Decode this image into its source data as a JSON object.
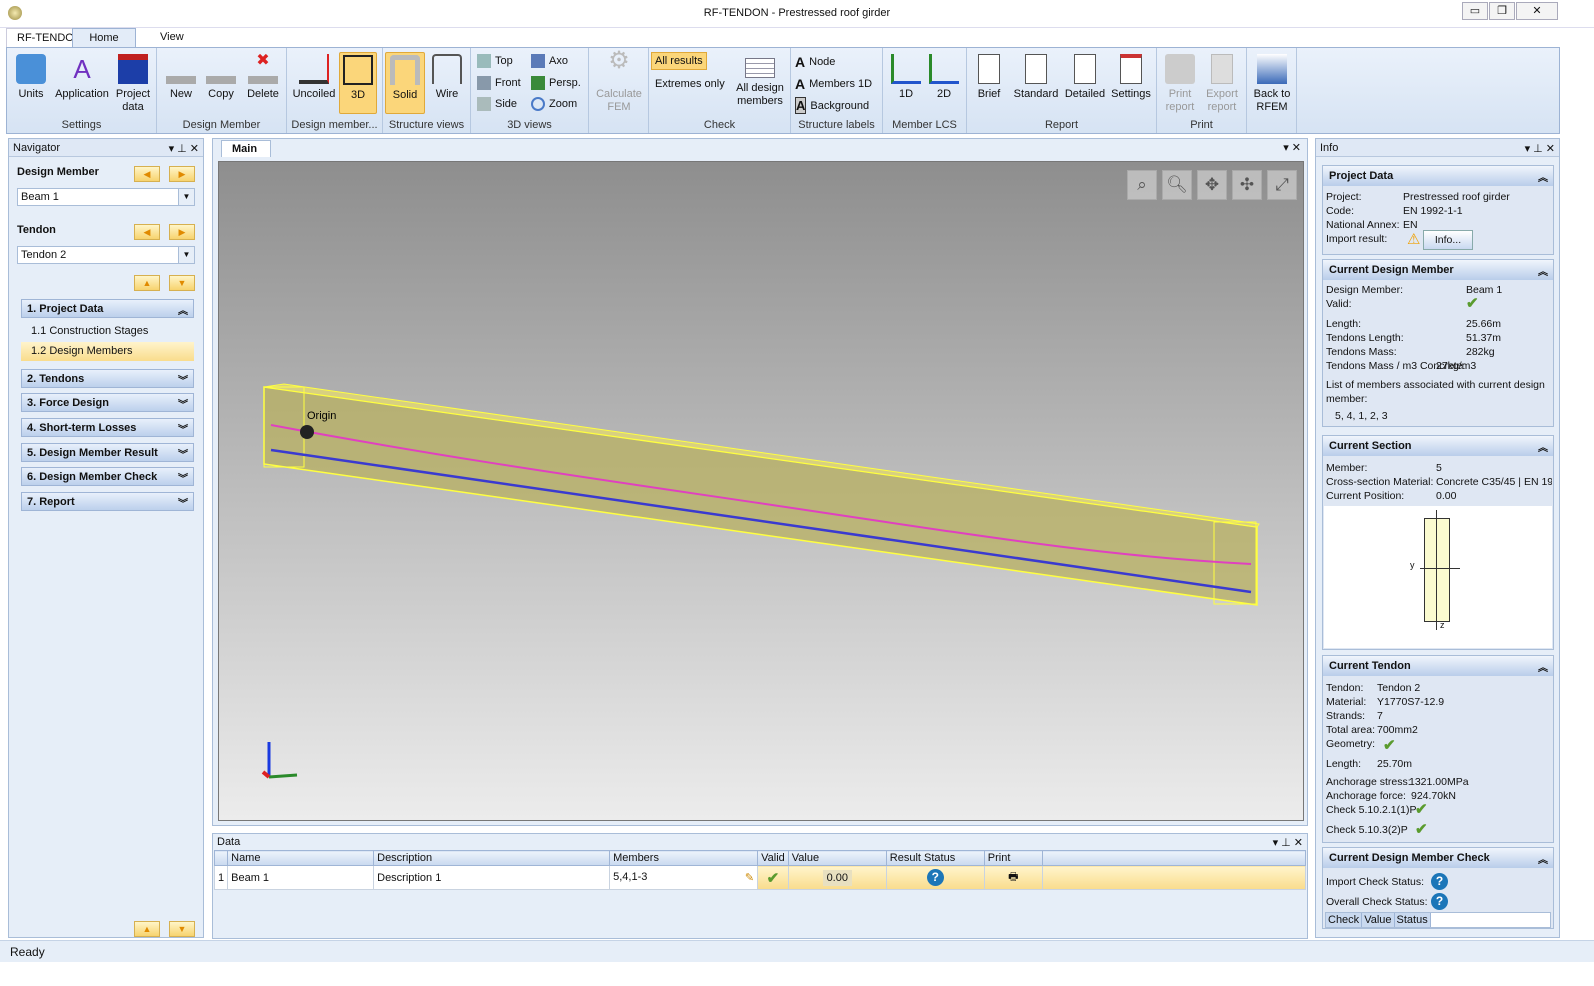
{
  "window": {
    "title": "RF-TENDON - Prestressed roof girder",
    "minimize": "▭",
    "restore": "❐",
    "close": "✕"
  },
  "tabs": [
    "RF-TENDON",
    "Home",
    "View"
  ],
  "ribbon": {
    "groups": [
      "Settings",
      "Design Member",
      "Design member...",
      "Structure views",
      "3D views",
      "",
      "Check",
      "Structure labels",
      "Member LCS",
      "Report",
      "Print",
      ""
    ],
    "settings": [
      "Units",
      "Application",
      "Project data"
    ],
    "design_member": [
      "New",
      "Copy",
      "Delete"
    ],
    "design_member2": [
      "Uncoiled",
      "3D"
    ],
    "structure_views": [
      "Solid",
      "Wire"
    ],
    "views3d": [
      "Top",
      "Front",
      "Side",
      "Axo",
      "Persp.",
      "Zoom"
    ],
    "calculate": "Calculate FEM",
    "check": [
      "All results",
      "Extremes only",
      "All design members"
    ],
    "labels": [
      "Node",
      "Members 1D",
      "Background"
    ],
    "lcs": [
      "1D",
      "2D"
    ],
    "report": [
      "Brief",
      "Standard",
      "Detailed",
      "Settings"
    ],
    "print": [
      "Print report",
      "Export report"
    ],
    "back": "Back to RFEM"
  },
  "navigator": {
    "title": "Navigator",
    "design_member_label": "Design Member",
    "design_member_value": "Beam 1",
    "tendon_label": "Tendon",
    "tendon_value": "Tendon 2",
    "sections": [
      {
        "label": "1. Project Data",
        "expanded": true,
        "items": [
          "1.1 Construction Stages",
          "1.2 Design Members"
        ],
        "selected": "1.2 Design Members"
      },
      {
        "label": "2. Tendons"
      },
      {
        "label": "3. Force Design"
      },
      {
        "label": "4. Short-term Losses"
      },
      {
        "label": "5. Design Member Result"
      },
      {
        "label": "6. Design Member Check"
      },
      {
        "label": "7. Report"
      }
    ]
  },
  "main": {
    "tab": "Main",
    "origin_label": "Origin",
    "colors": {
      "tendon_top": "#e040c0",
      "tendon_bottom": "#3a3ad0",
      "beam": "#c8c060"
    }
  },
  "data_panel": {
    "title": "Data",
    "columns": [
      "Name",
      "Description",
      "Members",
      "Valid",
      "Value",
      "Result Status",
      "Print"
    ],
    "rows": [
      {
        "index": "1",
        "name": "Beam 1",
        "description": "Description 1",
        "members": "5,4,1-3",
        "valid": "✔",
        "value": "0.00",
        "result_status": "?",
        "print": "🖶"
      }
    ]
  },
  "info": {
    "title": "Info",
    "project_data": {
      "title": "Project Data",
      "rows": [
        [
          "Project:",
          "Prestressed roof girder"
        ],
        [
          "Code:",
          "EN 1992-1-1"
        ],
        [
          "National Annex:",
          "EN"
        ],
        [
          "Import result:",
          ""
        ]
      ],
      "info_button": "Info..."
    },
    "current_design_member": {
      "title": "Current Design Member",
      "rows": [
        [
          "Design Member:",
          "Beam 1"
        ],
        [
          "Valid:",
          "✔"
        ],
        [
          "Length:",
          "25.66m"
        ],
        [
          "Tendons Length:",
          "51.37m"
        ],
        [
          "Tendons Mass:",
          "282kg"
        ],
        [
          "Tendons Mass / m3 Concrete:",
          "27kg/m3"
        ]
      ],
      "list_label": "List of members associated with current design member:",
      "list": "5, 4, 1, 2, 3"
    },
    "current_section": {
      "title": "Current Section",
      "rows": [
        [
          "Member:",
          "5"
        ],
        [
          "Cross-section Material:",
          "Concrete C35/45 | EN 19"
        ],
        [
          "Current Position:",
          "0.00"
        ]
      ],
      "axis_y": "y",
      "axis_z": "z"
    },
    "current_tendon": {
      "title": "Current Tendon",
      "rows": [
        [
          "Tendon:",
          "Tendon 2"
        ],
        [
          "Material:",
          "Y1770S7-12.9"
        ],
        [
          "Strands:",
          "7"
        ],
        [
          "Total area:",
          "700mm2"
        ],
        [
          "Geometry:",
          "✔"
        ],
        [
          "Length:",
          "25.70m"
        ],
        [
          "Anchorage stress:",
          "1321.00MPa"
        ],
        [
          "Anchorage force:",
          "924.70kN"
        ],
        [
          "Check 5.10.2.1(1)P",
          "✔"
        ],
        [
          "Check 5.10.3(2)P",
          "✔"
        ]
      ]
    },
    "current_check": {
      "title": "Current Design Member Check",
      "rows": [
        [
          "Import Check Status:",
          "?"
        ],
        [
          "Overall Check Status:",
          "?"
        ]
      ],
      "columns": [
        "Check",
        "Value",
        "Status"
      ]
    }
  },
  "status": "Ready"
}
